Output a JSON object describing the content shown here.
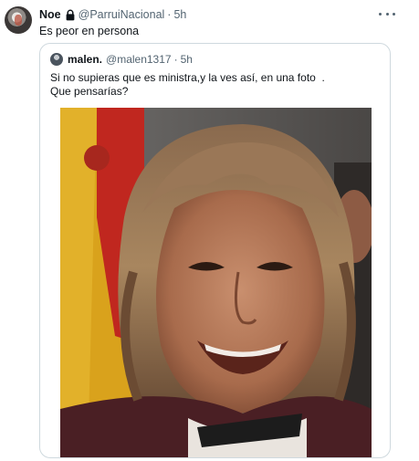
{
  "tweet": {
    "author": {
      "display_name": "Noe",
      "handle": "@ParruiNacional",
      "separator": "·",
      "time": "5h",
      "icons": {
        "lock": "lock-icon",
        "more": "more-icon"
      }
    },
    "text": "Es peor en persona",
    "quoted": {
      "display_name": "malen.",
      "handle": "@malen1317",
      "separator": "·",
      "time": "5h",
      "text_line1": "Si no supieras que es ministra,y la ves así, en una foto  .",
      "text_line2": "Que pensarías?",
      "image": "photo"
    }
  },
  "colors": {
    "primary_text": "#0f1419",
    "secondary_text": "#536471",
    "border": "#cfd9de",
    "background": "#ffffff"
  }
}
